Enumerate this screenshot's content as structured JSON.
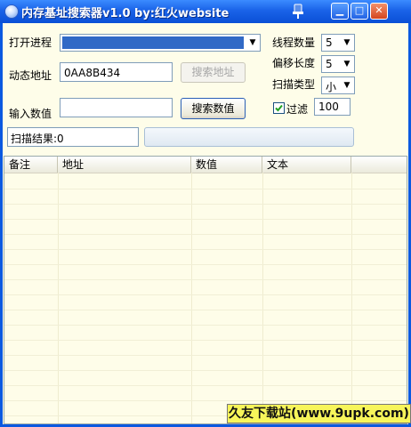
{
  "window": {
    "title": "内存基址搜索器v1.0  by:红火website"
  },
  "process": {
    "label": "打开进程",
    "value": ""
  },
  "threads": {
    "label": "线程数量",
    "value": "5"
  },
  "address": {
    "label": "动态地址",
    "value": "0AA8B434",
    "search_button": "搜索地址"
  },
  "offset": {
    "label": "偏移长度",
    "value": "5"
  },
  "scan_type": {
    "label": "扫描类型",
    "value": "小"
  },
  "input_value": {
    "label": "输入数值",
    "value": "",
    "search_button": "搜索数值"
  },
  "filter": {
    "label": "过滤",
    "checked": true,
    "value": "100"
  },
  "result": {
    "text": "扫描结果:0"
  },
  "table": {
    "columns": [
      "备注",
      "地址",
      "数值",
      "文本"
    ]
  },
  "watermark": {
    "text": "久友下载站(www.9upk.com)"
  },
  "colors": {
    "titlebar": "#1a63e8",
    "client_bg": "#fefde9",
    "selection": "#3169c6"
  }
}
